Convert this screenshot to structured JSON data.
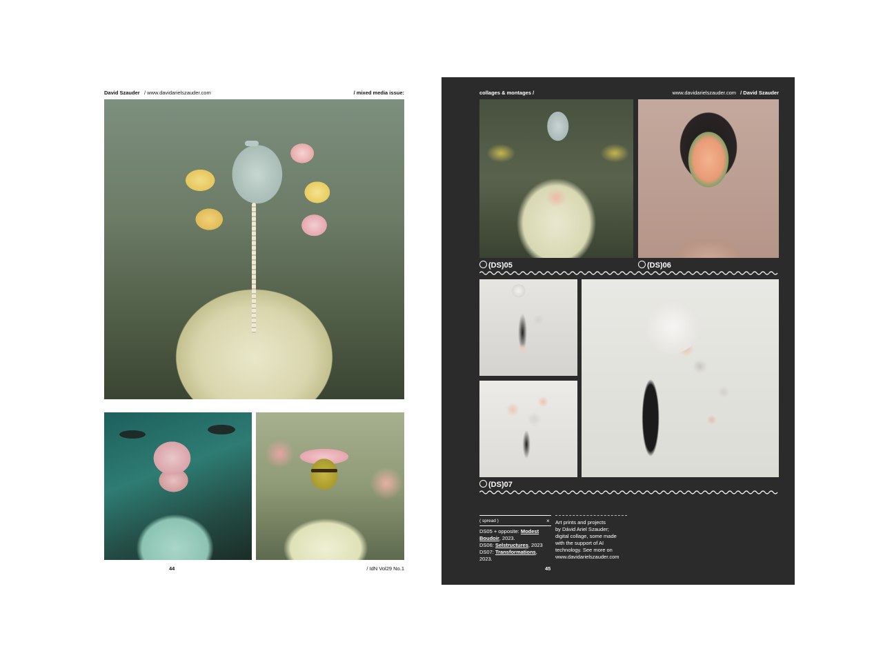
{
  "left_page": {
    "header_author": "David Szauder",
    "header_url": "/ www.davidarielszauder.com",
    "header_issue": "/ mixed media issue:",
    "page_number": "44",
    "footer_mag": "/ IdN Vol29 No.1"
  },
  "right_page": {
    "header_section": "collages & montages /",
    "header_url": "www.davidarielszauder.com",
    "header_author": "/ David Szauder",
    "labels": {
      "ds05_prefix": "(",
      "ds05_ds": "DS",
      "ds05_suffix": ")05",
      "ds06_prefix": "(",
      "ds06_ds": "DS",
      "ds06_suffix": ")06",
      "ds07_prefix": "(",
      "ds07_ds": "DS",
      "ds07_suffix": ")07"
    },
    "spread": {
      "tag": "( spread )",
      "close": "×",
      "line1_a": "DS05 + opposite: ",
      "line1_b": "Modest",
      "line2_a": "Boudoir",
      "line2_b": ", 2023.",
      "line3_a": "DS06: ",
      "line3_b": "Selstructures",
      "line3_c": ", 2023",
      "line4_a": "DS07: ",
      "line4_b": "Transformations",
      "line4_c": ",",
      "line5": "2023."
    },
    "description": [
      "Art prints and projects",
      "by Dávid Ariel Szauder;",
      "digital collage, some made",
      "with the support of AI",
      "technology. See more on",
      "www.davidarielszauder.com"
    ],
    "page_number": "45"
  }
}
